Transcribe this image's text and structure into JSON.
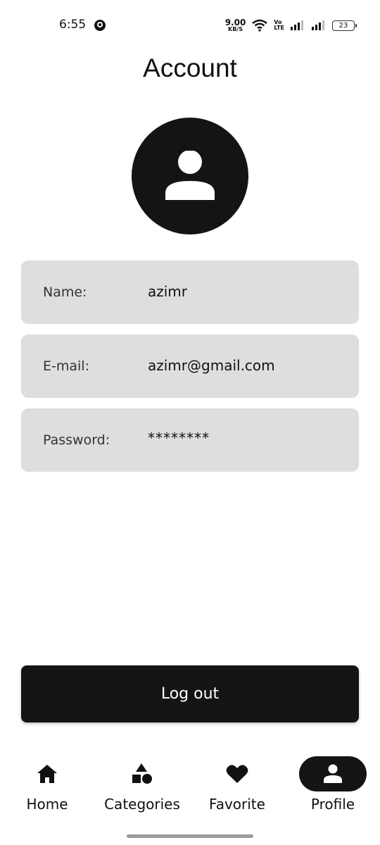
{
  "status_bar": {
    "time": "6:55",
    "net_speed_value": "9.00",
    "net_speed_unit": "KB/S",
    "volte_top": "Vo",
    "volte_bottom": "LTE",
    "battery": "23"
  },
  "header": {
    "title": "Account"
  },
  "profile": {
    "name_label": "Name:",
    "name_value": "azimr",
    "email_label": "E-mail:",
    "email_value": "azimr@gmail.com",
    "password_label": "Password:",
    "password_value": "********"
  },
  "actions": {
    "logout_label": "Log out"
  },
  "bottom_nav": {
    "items": [
      {
        "label": "Home",
        "icon": "home-icon",
        "active": false
      },
      {
        "label": "Categories",
        "icon": "categories-icon",
        "active": false
      },
      {
        "label": "Favorite",
        "icon": "heart-icon",
        "active": false
      },
      {
        "label": "Profile",
        "icon": "person-icon",
        "active": true
      }
    ]
  },
  "colors": {
    "primary": "#141414",
    "card_background": "#dedede",
    "background": "#ffffff",
    "text": "#111111"
  }
}
